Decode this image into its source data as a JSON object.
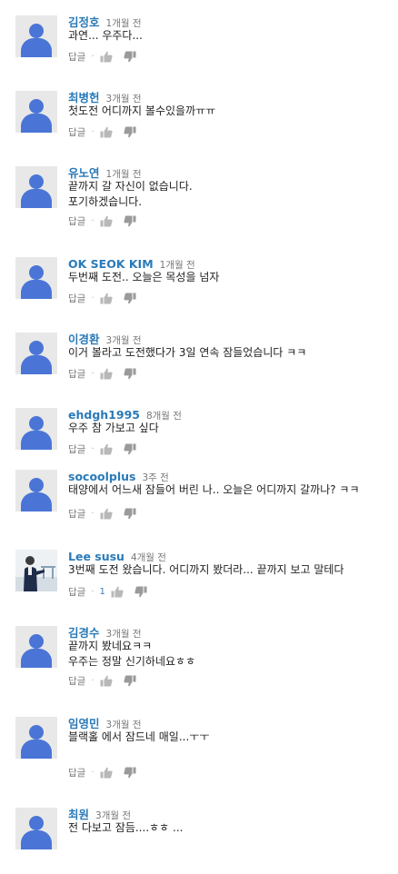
{
  "reply_label": "답글",
  "separator": "·",
  "comments": [
    {
      "author": "김정호",
      "time": "1개월 전",
      "lines": [
        "과연... 우주다..."
      ],
      "likes": ""
    },
    {
      "author": "최병헌",
      "time": "3개월 전",
      "lines": [
        "첫도전 어디까지 볼수있을까ㅠㅠ"
      ],
      "likes": ""
    },
    {
      "author": "유노연",
      "time": "1개월 전",
      "lines": [
        "끝까지 갈 자신이 없습니다.",
        "포기하겠습니다."
      ],
      "likes": ""
    },
    {
      "author": "OK SEOK KIM",
      "time": "1개월 전",
      "lines": [
        "두번째 도전.. 오늘은 목성을 넘자"
      ],
      "likes": ""
    },
    {
      "author": "이경환",
      "time": "3개월 전",
      "lines": [
        "이거 볼라고 도전했다가 3일 연속 잠들었습니다 ㅋㅋ"
      ],
      "likes": ""
    },
    {
      "author": "ehdgh1995",
      "time": "8개월 전",
      "lines": [
        "우주 참 가보고 싶다"
      ],
      "likes": ""
    },
    {
      "author": "socoolplus",
      "time": "3주 전",
      "lines": [
        "태양에서 어느새 잠들어 버린 나.. 오늘은 어디까지 갈까나? ㅋㅋ"
      ],
      "likes": ""
    },
    {
      "author": "Lee susu",
      "time": "4개월 전",
      "lines": [
        "3번째 도전 왔습니다. 어디까지 봤더라... 끝까지 보고 말테다"
      ],
      "likes": "1"
    },
    {
      "author": "김경수",
      "time": "3개월 전",
      "lines": [
        "끝까지 봤네요ㅋㅋ",
        "우주는 정말 신기하네요ㅎㅎ"
      ],
      "likes": ""
    },
    {
      "author": "임영민",
      "time": "3개월 전",
      "lines": [
        "블랙홀 에서 잠드네 매일...ㅜㅜ"
      ],
      "likes": ""
    },
    {
      "author": "최원",
      "time": "3개월 전",
      "lines": [
        "전 다보고 잠듬....ㅎㅎ ..."
      ],
      "likes": ""
    }
  ],
  "colors": {
    "author": "#2a7ab8",
    "avatar_blue": "#4a75d6",
    "avatar_bg": "#e8e8e8",
    "text": "#222222",
    "muted": "#777777"
  },
  "icons": {
    "like": "thumbs-up-icon",
    "dislike": "thumbs-down-icon"
  }
}
